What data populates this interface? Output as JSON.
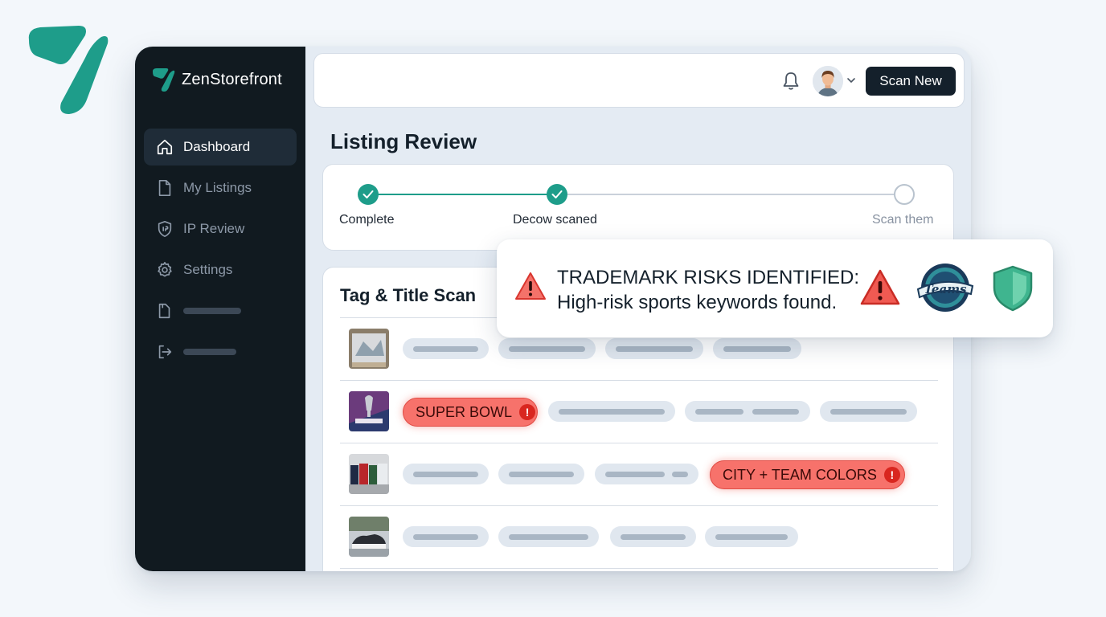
{
  "brand": {
    "name": "ZenStorefront",
    "accent": "#1e9d8a"
  },
  "sidebar": {
    "items": [
      {
        "label": "Dashboard",
        "icon": "home-icon",
        "active": true
      },
      {
        "label": "My Listings",
        "icon": "document-icon"
      },
      {
        "label": "IP Review",
        "icon": "shield-ip-icon"
      },
      {
        "label": "Settings",
        "icon": "gear-icon"
      },
      {
        "label": "",
        "icon": "file-icon",
        "placeholder": true
      },
      {
        "label": "",
        "icon": "logout-icon",
        "placeholder": true
      }
    ]
  },
  "topbar": {
    "scan_button": "Scan New",
    "bell_icon": "bell-icon",
    "avatar": "user-avatar"
  },
  "page": {
    "title": "Listing Review"
  },
  "stepper": {
    "steps": [
      {
        "label": "Complete",
        "status": "done"
      },
      {
        "label": "Decow scaned",
        "status": "done"
      },
      {
        "label": "Scan them",
        "status": "pending"
      }
    ]
  },
  "scan": {
    "title": "Tag & Title Scan",
    "rows": [
      {
        "thumb": "product-thumbnail-1",
        "risk": null
      },
      {
        "thumb": "product-thumbnail-2",
        "risk": {
          "label": "SUPER BOWL",
          "mark": "!"
        }
      },
      {
        "thumb": "product-thumbnail-3",
        "risk": {
          "label": "CITY + TEAM COLORS",
          "mark": "!"
        }
      },
      {
        "thumb": "product-thumbnail-4",
        "risk": null
      }
    ]
  },
  "alert": {
    "line1": "TRADEMARK RISKS IDENTIFIED:",
    "line2": "High-risk sports keywords found.",
    "badge_text": "Teams",
    "risk_color": "#f05a52",
    "shield_color": "#3fb58f"
  }
}
